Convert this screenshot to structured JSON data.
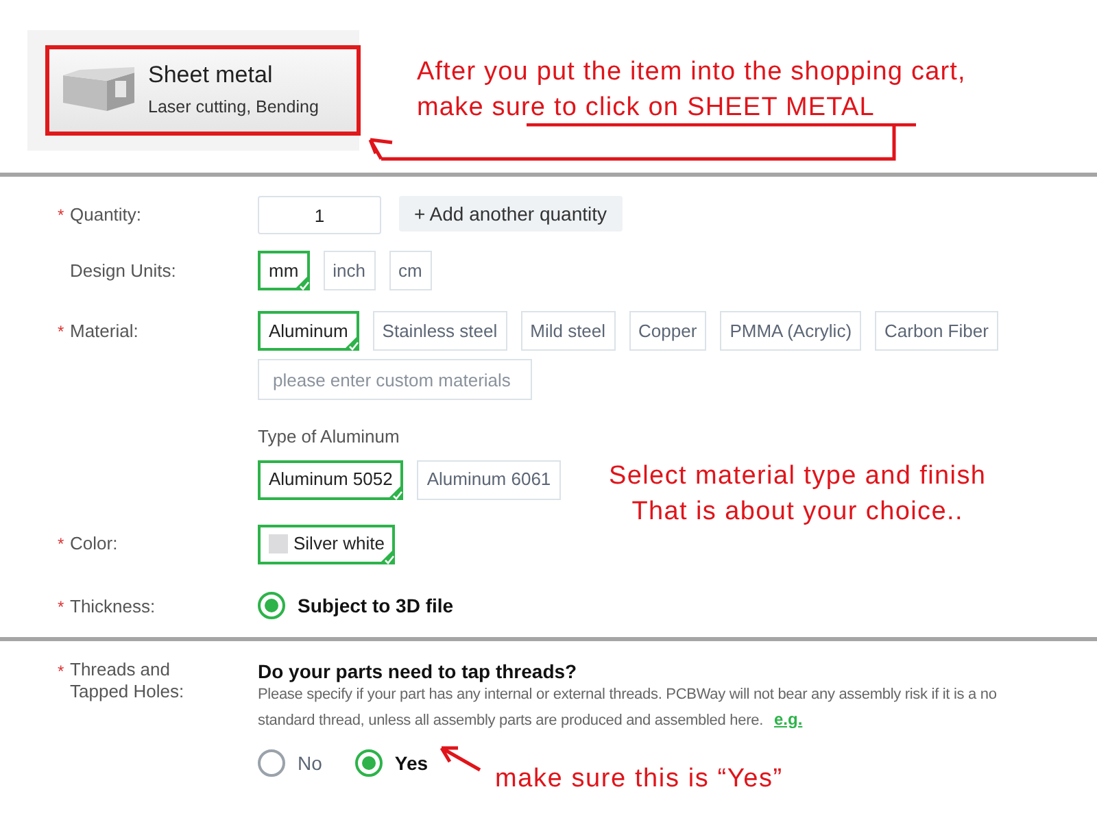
{
  "product_card": {
    "title": "Sheet metal",
    "subtitle": "Laser cutting, Bending"
  },
  "top_note": {
    "line_1": "After you put the item into the shopping cart,",
    "line_2": "make sure to click on",
    "emphasis": "SHEET METAL"
  },
  "quantity": {
    "required_mark": "*",
    "label": "Quantity:",
    "value": "1",
    "add_button": "+ Add another quantity"
  },
  "design_units": {
    "label": "Design Units:",
    "options": [
      {
        "label": "mm",
        "selected": true
      },
      {
        "label": "inch",
        "selected": false
      },
      {
        "label": "cm",
        "selected": false
      }
    ]
  },
  "material": {
    "required_mark": "*",
    "label": "Material:",
    "options": [
      {
        "label": "Aluminum",
        "selected": true
      },
      {
        "label": "Stainless steel",
        "selected": false
      },
      {
        "label": "Mild steel",
        "selected": false
      },
      {
        "label": "Copper",
        "selected": false
      },
      {
        "label": "PMMA (Acrylic)",
        "selected": false
      },
      {
        "label": "Carbon Fiber",
        "selected": false
      }
    ],
    "custom_placeholder": "please enter custom materials"
  },
  "aluminum_type": {
    "label": "Type of Aluminum",
    "options": [
      {
        "label": "Aluminum 5052",
        "selected": true
      },
      {
        "label": "Aluminum 6061",
        "selected": false
      }
    ]
  },
  "middle_note": {
    "lines": [
      "Select material type and finish",
      "That is about your choice.."
    ]
  },
  "color": {
    "required_mark": "*",
    "label": "Color:",
    "options": [
      {
        "label": "Silver white",
        "selected": true
      }
    ]
  },
  "thickness": {
    "required_mark": "*",
    "label": "Thickness:",
    "options": [
      {
        "label": "Subject to 3D file",
        "selected": true
      }
    ]
  },
  "threads": {
    "required_mark": "*",
    "label": "Threads and Tapped Holes:",
    "question": "Do your parts need to tap threads?",
    "description_line_1": "Please specify if your part has any internal or external threads. PCBWay will not bear any assembly risk if it is a no",
    "description_line_2": "standard thread, unless all assembly parts are produced and assembled here.",
    "link": "e.g.",
    "options": [
      {
        "label": "No",
        "selected": false
      },
      {
        "label": "Yes",
        "selected": true
      }
    ]
  },
  "bottom_note": {
    "text": "make sure this is “Yes”"
  }
}
